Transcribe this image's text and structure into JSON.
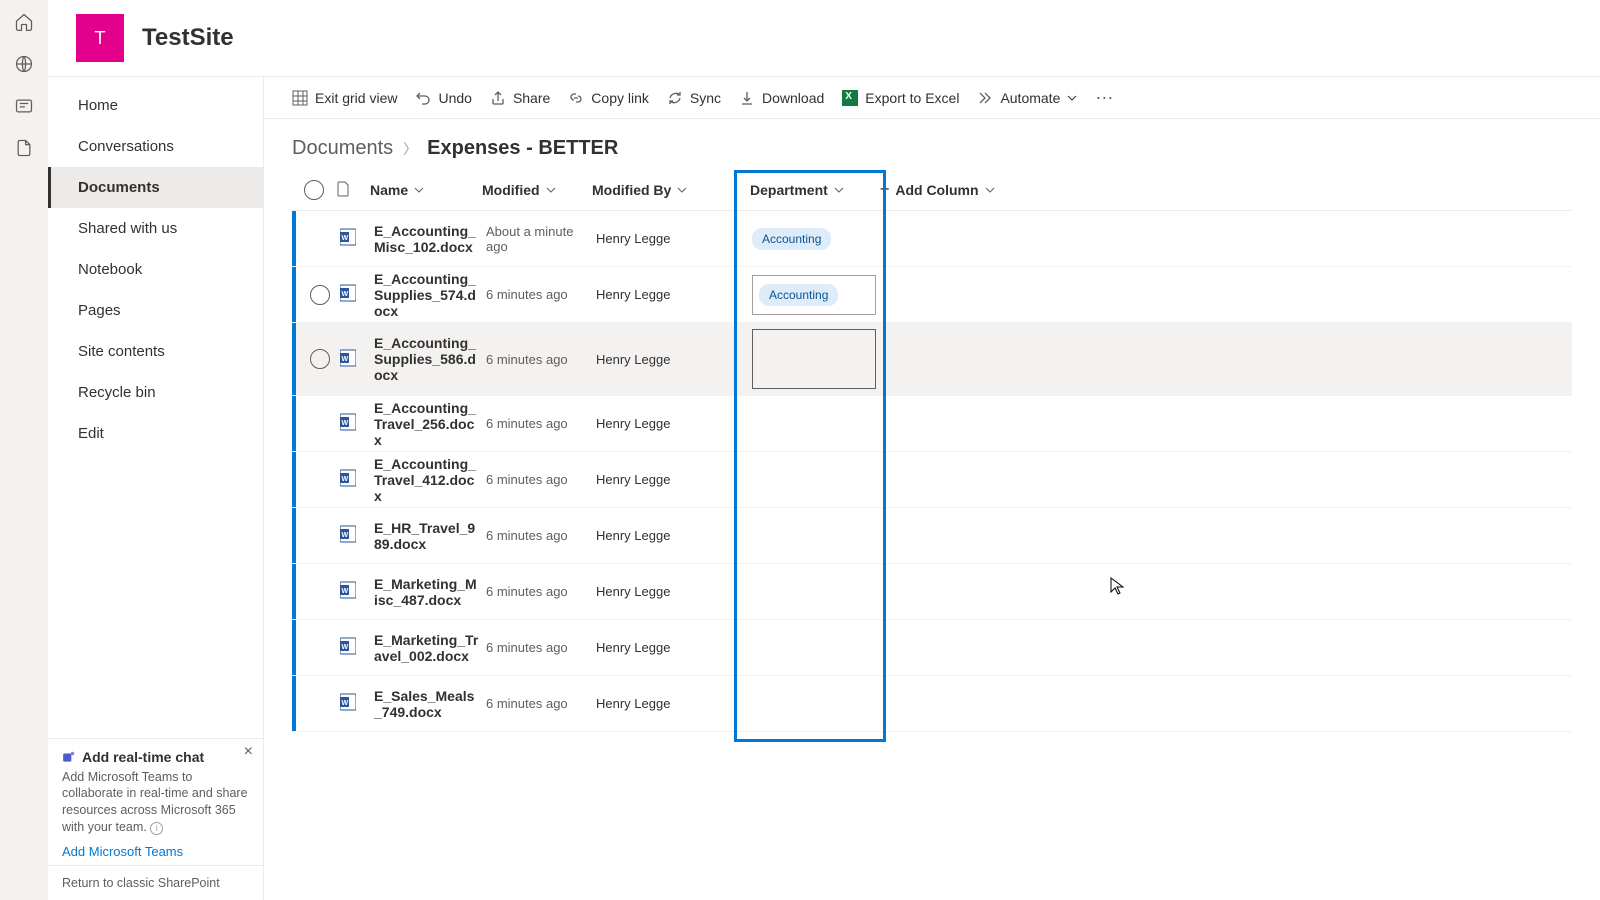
{
  "site": {
    "logo_letter": "T",
    "title": "TestSite"
  },
  "rail_icons": [
    "home",
    "globe",
    "news",
    "file"
  ],
  "leftnav": {
    "items": [
      {
        "label": "Home"
      },
      {
        "label": "Conversations"
      },
      {
        "label": "Documents",
        "active": true
      },
      {
        "label": "Shared with us"
      },
      {
        "label": "Notebook"
      },
      {
        "label": "Pages"
      },
      {
        "label": "Site contents"
      },
      {
        "label": "Recycle bin"
      },
      {
        "label": "Edit"
      }
    ]
  },
  "promo": {
    "title": "Add real-time chat",
    "desc": "Add Microsoft Teams to collaborate in real-time and share resources across Microsoft 365 with your team.",
    "link": "Add Microsoft Teams",
    "close": "×"
  },
  "return_link": "Return to classic SharePoint",
  "toolbar": {
    "exit_grid": "Exit grid view",
    "undo": "Undo",
    "share": "Share",
    "copylink": "Copy link",
    "sync": "Sync",
    "download": "Download",
    "export": "Export to Excel",
    "automate": "Automate",
    "more": "···"
  },
  "breadcrumb": {
    "root": "Documents",
    "current": "Expenses - BETTER"
  },
  "columns": {
    "name": "Name",
    "modified": "Modified",
    "modified_by": "Modified By",
    "department": "Department",
    "add": "Add Column"
  },
  "rows": [
    {
      "name": "E_Accounting_Misc_102.docx",
      "modified": "About a minute ago",
      "by": "Henry Legge",
      "dept": "Accounting",
      "sel": false,
      "hover": false
    },
    {
      "name": "E_Accounting_Supplies_574.docx",
      "modified": "6 minutes ago",
      "by": "Henry Legge",
      "dept": "Accounting",
      "sel": true,
      "hover": false,
      "dept_box": true
    },
    {
      "name": "E_Accounting_Supplies_586.docx",
      "modified": "6 minutes ago",
      "by": "Henry Legge",
      "dept": "",
      "sel": true,
      "hover": true,
      "dept_active": true
    },
    {
      "name": "E_Accounting_Travel_256.docx",
      "modified": "6 minutes ago",
      "by": "Henry Legge",
      "dept": "",
      "sel": false,
      "hover": false
    },
    {
      "name": "E_Accounting_Travel_412.docx",
      "modified": "6 minutes ago",
      "by": "Henry Legge",
      "dept": "",
      "sel": false,
      "hover": false
    },
    {
      "name": "E_HR_Travel_989.docx",
      "modified": "6 minutes ago",
      "by": "Henry Legge",
      "dept": "",
      "sel": false,
      "hover": false
    },
    {
      "name": "E_Marketing_Misc_487.docx",
      "modified": "6 minutes ago",
      "by": "Henry Legge",
      "dept": "",
      "sel": false,
      "hover": false
    },
    {
      "name": "E_Marketing_Travel_002.docx",
      "modified": "6 minutes ago",
      "by": "Henry Legge",
      "dept": "",
      "sel": false,
      "hover": false
    },
    {
      "name": "E_Sales_Meals_749.docx",
      "modified": "6 minutes ago",
      "by": "Henry Legge",
      "dept": "",
      "sel": false,
      "hover": false
    }
  ]
}
